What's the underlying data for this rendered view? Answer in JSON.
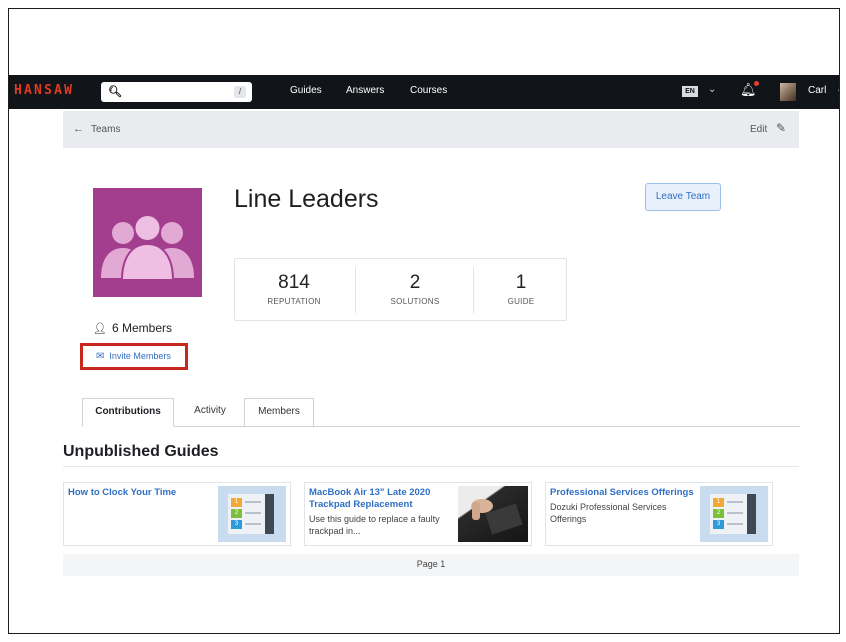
{
  "navbar": {
    "logo": "HANSAW",
    "search": {
      "placeholder": "",
      "shortcut": "/"
    },
    "links": [
      "Guides",
      "Answers",
      "Courses"
    ],
    "language": "EN",
    "user_name": "Carl"
  },
  "breadcrumb": {
    "back_label": "Teams",
    "edit_label": "Edit"
  },
  "team": {
    "name": "Line Leaders",
    "leave_button": "Leave Team",
    "stats": [
      {
        "value": "814",
        "label": "REPUTATION"
      },
      {
        "value": "2",
        "label": "SOLUTIONS"
      },
      {
        "value": "1",
        "label": "GUIDE"
      }
    ],
    "members_count": "6 Members",
    "invite_label": "Invite Members",
    "image_color": "#a33e8f"
  },
  "tabs": [
    {
      "label": "Contributions",
      "active": true
    },
    {
      "label": "Activity",
      "active": false
    },
    {
      "label": "Members",
      "active": false
    }
  ],
  "unpublished": {
    "heading": "Unpublished Guides",
    "guides": [
      {
        "title": "How to Clock Your Time",
        "desc": ""
      },
      {
        "title": "MacBook Air 13\" Late 2020 Trackpad Replacement",
        "title_lines": [
          "MacBook Air 13\" Late 2020",
          "Trackpad Replacement"
        ],
        "desc_lines": [
          "Use this guide to replace a faulty",
          "trackpad in..."
        ]
      },
      {
        "title": "Professional Services Offerings",
        "desc_lines": [
          "Dozuki Professional Services",
          "Offerings"
        ]
      }
    ],
    "pager": "Page 1"
  },
  "colors": {
    "navbar": "#111419",
    "logo": "#e03a21",
    "link": "#2f6fc4",
    "highlight": "#c7281d"
  }
}
